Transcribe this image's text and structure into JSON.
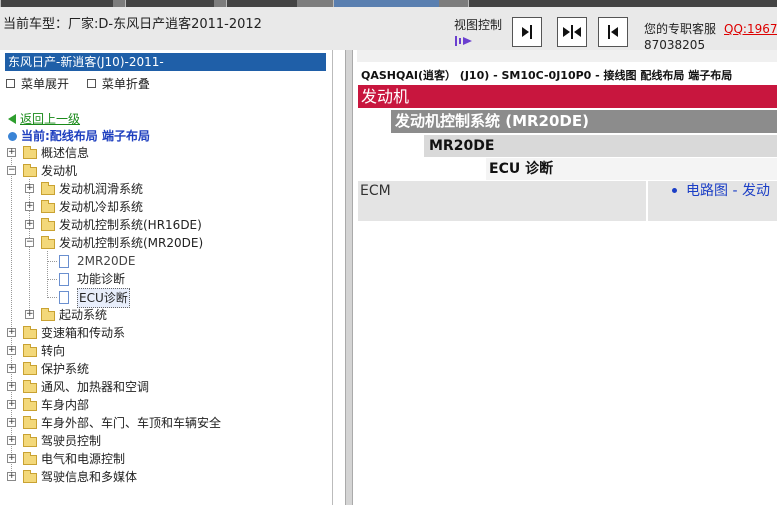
{
  "header": {
    "title": "当前车型：厂家:D-东风日产逍客2011-2012",
    "view_control_label": "视图控制",
    "support_label": "您的专职客服",
    "qq_label": "QQ:1967",
    "phone": "87038205"
  },
  "sidebar": {
    "selected_title": "东风日产-新逍客(J10)-2011-",
    "expand_all": "菜单展开",
    "collapse_all": "菜单折叠",
    "back_link": "返回上一级",
    "current_location": "当前:配线布局 端子布局",
    "tree": [
      {
        "label": "概述信息"
      },
      {
        "label": "发动机"
      },
      {
        "label": "发动机润滑系统"
      },
      {
        "label": "发动机冷却系统"
      },
      {
        "label": "发动机控制系统(HR16DE)"
      },
      {
        "label": "发动机控制系统(MR20DE)"
      },
      {
        "label": "2MR20DE"
      },
      {
        "label": "功能诊断"
      },
      {
        "label": "ECU诊断"
      },
      {
        "label": "起动系统"
      },
      {
        "label": "变速箱和传动系"
      },
      {
        "label": "转向"
      },
      {
        "label": "保护系统"
      },
      {
        "label": "通风、加热器和空调"
      },
      {
        "label": "车身内部"
      },
      {
        "label": "车身外部、车门、车顶和车辆安全"
      },
      {
        "label": "驾驶员控制"
      },
      {
        "label": "电气和电源控制"
      },
      {
        "label": "驾驶信息和多媒体"
      }
    ]
  },
  "content": {
    "doc_header": "QASHQAI(逍客） (J10) - SM10C-0J10P0 - 接线图 配线布局 端子布局",
    "section": "发动机",
    "subsection": "发动机控制系统 (MR20DE)",
    "engine": "MR20DE",
    "topic": "ECU 诊断",
    "row_label": "ECM",
    "row_link": "电路图 - 发动"
  },
  "colors": {
    "selected_bg": "#1f5fa8",
    "section_red": "#c8163e",
    "link_blue": "#1c3fc6",
    "back_green": "#1a8a1a",
    "current_blue": "#1e3fbf"
  }
}
